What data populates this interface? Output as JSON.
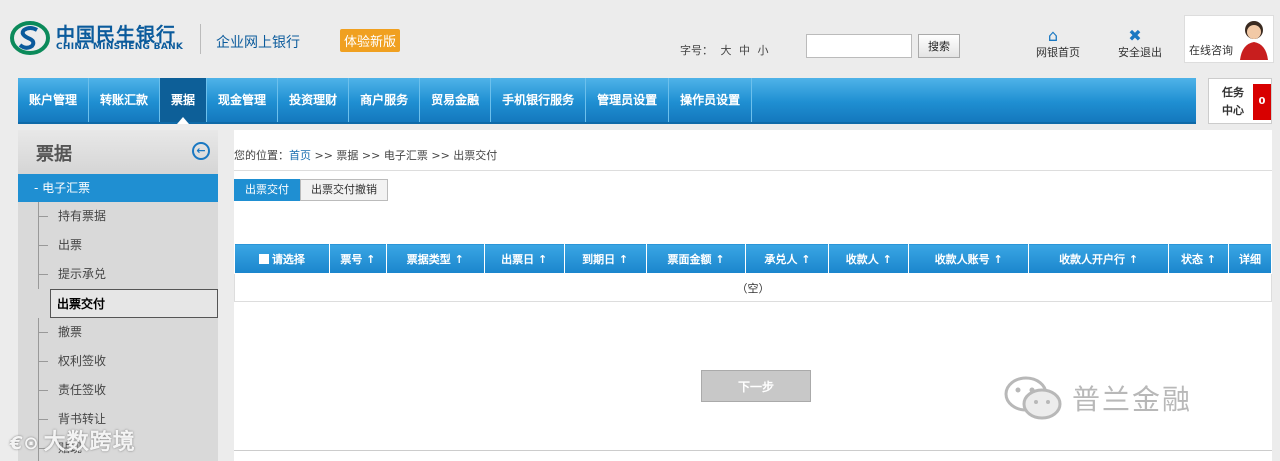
{
  "header": {
    "bank_name_cn": "中国民生银行",
    "bank_name_en": "CHINA MINSHENG BANK",
    "system_name": "企业网上银行",
    "trial_badge": "体验新版",
    "font_size_label": "字号： 大 中 小",
    "search_placeholder": "",
    "search_button": "搜索",
    "home_link": "网银首页",
    "logout_link": "安全退出",
    "consult_label": "在线咨询"
  },
  "nav": {
    "items": [
      "账户管理",
      "转账汇款",
      "票据",
      "现金管理",
      "投资理财",
      "商户服务",
      "贸易金融",
      "手机银行服务",
      "管理员设置",
      "操作员设置"
    ],
    "active": "票据"
  },
  "task_center": {
    "label": "任务中心",
    "count": "0"
  },
  "sidebar": {
    "title": "票据",
    "group": "- 电子汇票",
    "items": [
      "持有票据",
      "出票",
      "提示承兑",
      "出票交付",
      "撤票",
      "权利签收",
      "责任签收",
      "背书转让",
      "贴现"
    ],
    "active": "出票交付"
  },
  "breadcrumb": {
    "prefix": "您的位置：",
    "home": "首页",
    "rest": " >> 票据 >> 电子汇票 >> 出票交付"
  },
  "tabs": [
    "出票交付",
    "出票交付撤销"
  ],
  "table": {
    "columns": [
      "请选择",
      "票号 ↑",
      "票据类型 ↑",
      "出票日 ↑",
      "到期日 ↑",
      "票面金额 ↑",
      "承兑人 ↑",
      "收款人 ↑",
      "收款人账号 ↑",
      "收款人开户行 ↑",
      "状态 ↑",
      "详细"
    ],
    "empty_text": "（空）"
  },
  "next_button": "下一步",
  "watermarks": {
    "right": "普兰金融",
    "left": "大数跨境"
  },
  "colors": {
    "primary_blue": "#1f8fd2",
    "nav_active": "#0d5f98",
    "brand_blue": "#0b5b9c",
    "badge_orange": "#f0a020",
    "alert_red": "#d80000"
  }
}
